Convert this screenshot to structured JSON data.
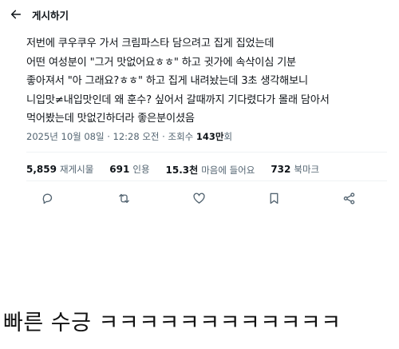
{
  "header": {
    "back_icon": "arrow-left-icon",
    "title": "게시하기"
  },
  "post": {
    "lines": [
      "저번에 쿠우쿠우 가서 크림파스타 담으려고 집게 집었는데",
      "어떤 여성분이 \"그거 맛없어요ㅎㅎ\" 하고 귓가에 속삭이심 기분",
      "좋아져서 \"아 그래요?ㅎㅎ\" 하고 집게 내려놨는데 3초 생각해보니",
      "니입맛≠내입맛인데 왜 훈수? 싶어서 갈때까지 기다렸다가 몰래 담아서",
      "먹어봤는데 맛없긴하더라 좋은분이셨음"
    ],
    "meta": {
      "datetime": "2025년 10월 08일 · 12:28 오전 · ",
      "views_label": "조회수 ",
      "views_value": "143만",
      "views_unit": "회"
    }
  },
  "stats": {
    "reposts": {
      "value": "5,859",
      "label": "재게시물"
    },
    "quotes": {
      "value": "691",
      "label": "인용"
    },
    "likes": {
      "value": "15.3천",
      "label": "마음에 들어요"
    },
    "bookmarks": {
      "value": "732",
      "label": "북마크"
    }
  },
  "actions": {
    "reply_icon": "reply-icon",
    "repost_icon": "repost-icon",
    "like_icon": "heart-icon",
    "bookmark_icon": "bookmark-icon",
    "share_icon": "share-icon"
  },
  "caption": "빠른 수긍 ㅋㅋㅋㅋㅋㅋㅋㅋㅋㅋㅋㅋ",
  "colors": {
    "text": "#0f1419",
    "secondary": "#536471",
    "divider": "#eff3f4"
  }
}
